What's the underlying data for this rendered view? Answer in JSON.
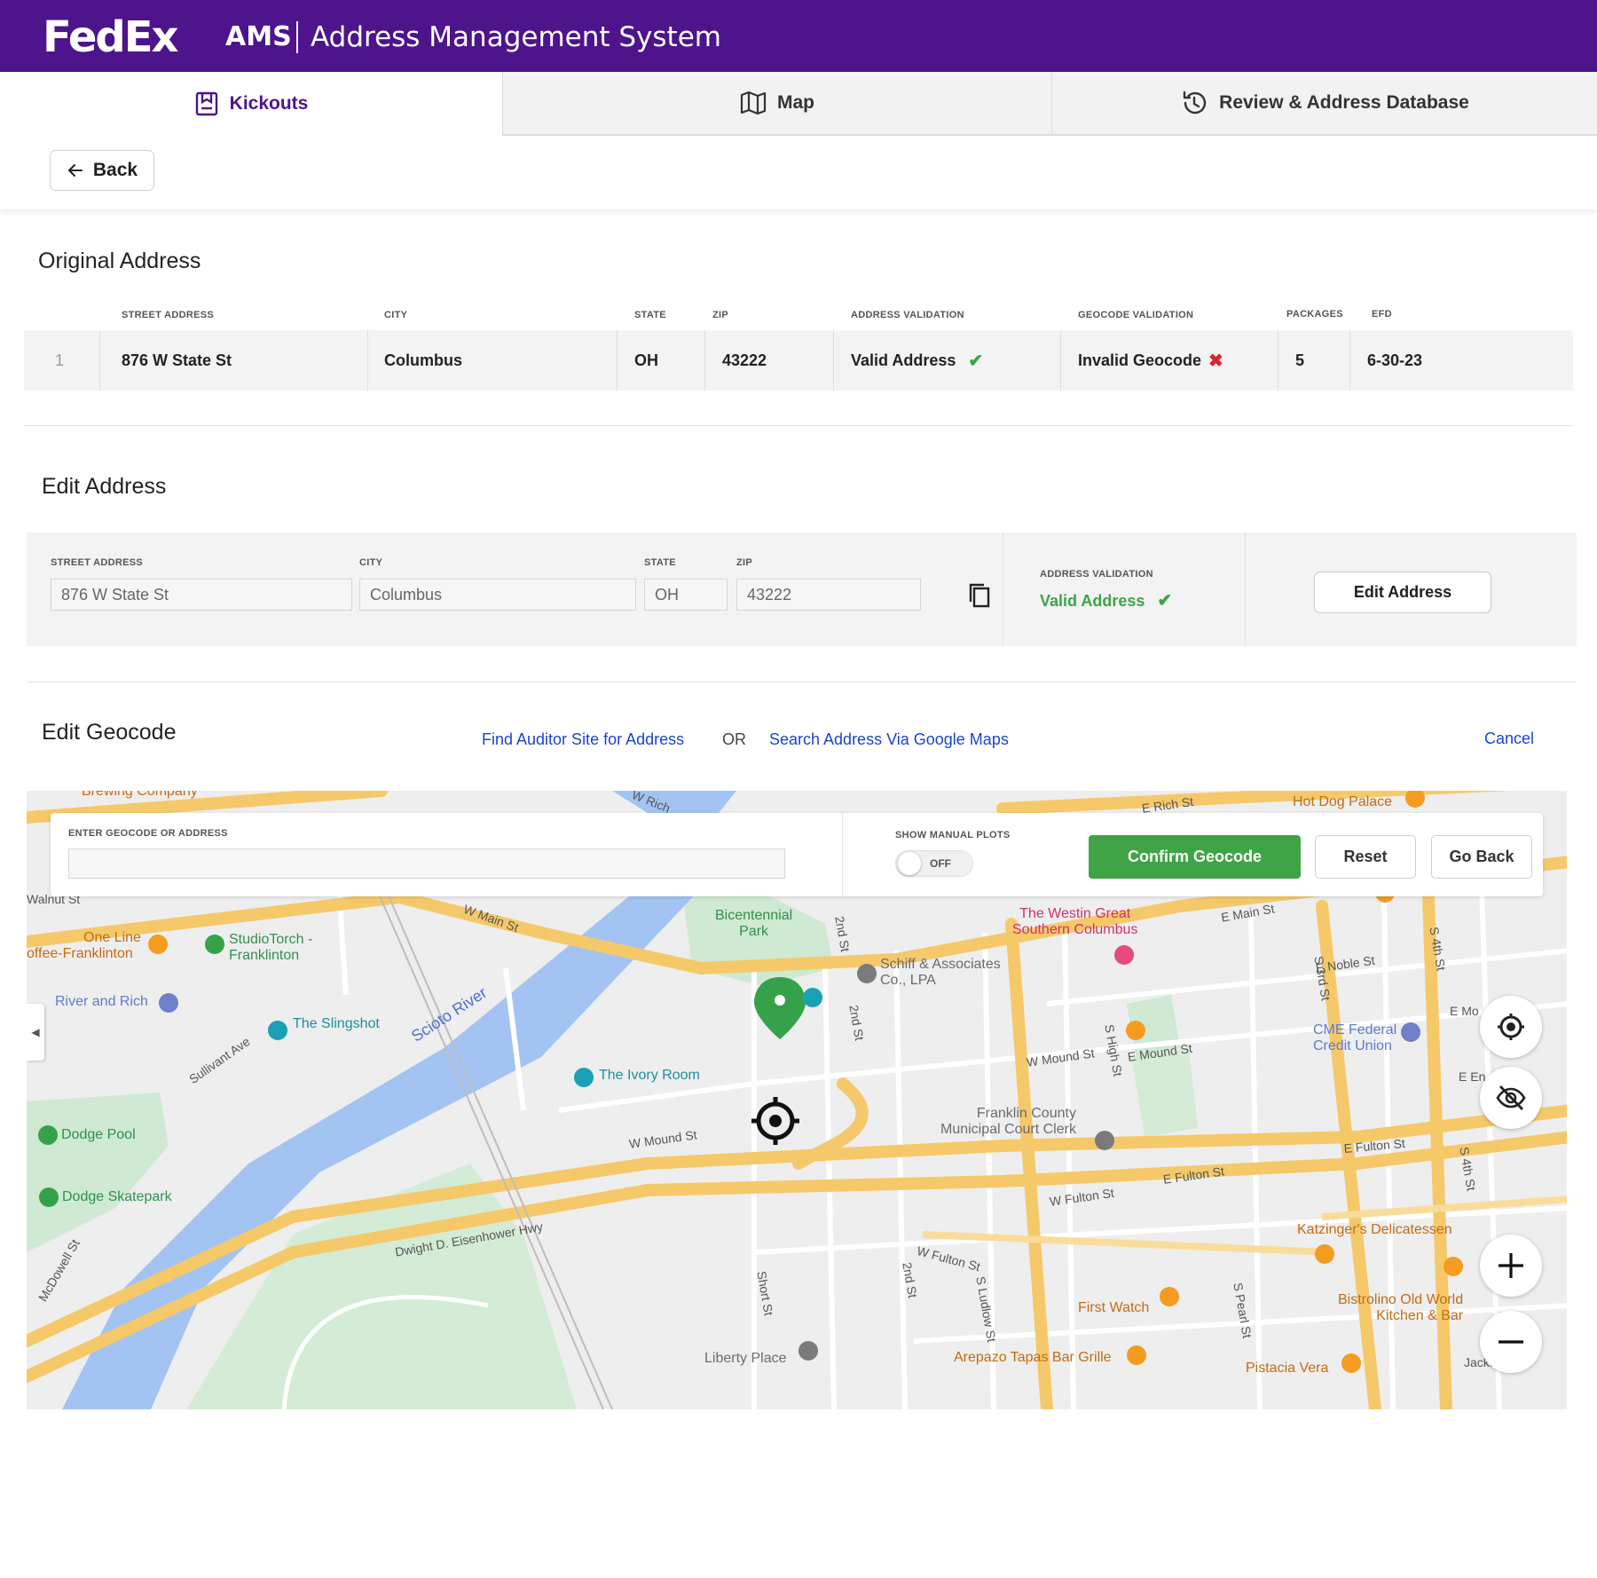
{
  "header": {
    "logo": "FedEx",
    "app_abbr": "AMS",
    "app_name": "Address Management System"
  },
  "tabs": [
    {
      "label": "Kickouts",
      "icon": "clipboard-icon",
      "active": true
    },
    {
      "label": "Map",
      "icon": "map-icon",
      "active": false
    },
    {
      "label": "Review & Address Database",
      "icon": "history-icon",
      "active": false
    }
  ],
  "back_label": "Back",
  "original": {
    "title": "Original Address",
    "headers": {
      "street": "STREET ADDRESS",
      "city": "CITY",
      "state": "STATE",
      "zip": "ZIP",
      "address_validation": "ADDRESS VALIDATION",
      "geocode_validation": "GEOCODE VALIDATION",
      "packages": "PACKAGES",
      "efd": "EFD"
    },
    "row": {
      "num": "1",
      "street": "876 W State St",
      "city": "Columbus",
      "state": "OH",
      "zip": "43222",
      "address_validation": "Valid Address",
      "geocode_validation": "Invalid Geocode",
      "packages": "5",
      "efd": "6-30-23"
    }
  },
  "edit_address": {
    "title": "Edit Address",
    "labels": {
      "street": "STREET ADDRESS",
      "city": "CITY",
      "state": "STATE",
      "zip": "ZIP",
      "validation": "ADDRESS VALIDATION"
    },
    "values": {
      "street": "876 W State St",
      "city": "Columbus",
      "state": "OH",
      "zip": "43222"
    },
    "validation": "Valid Address",
    "button": "Edit Address"
  },
  "edit_geocode": {
    "title": "Edit Geocode",
    "link_auditor": "Find Auditor Site for Address",
    "or": "OR",
    "link_google": "Search Address Via Google Maps",
    "cancel": "Cancel",
    "input_label": "ENTER GEOCODE OR ADDRESS",
    "input_value": "",
    "manual_plots_label": "SHOW MANUAL PLOTS",
    "toggle_state": "OFF",
    "confirm": "Confirm Geocode",
    "reset": "Reset",
    "go_back": "Go Back"
  },
  "map": {
    "places": {
      "bicentennial": "Bicentennial\nPark",
      "westin": "The Westin Great\nSouthern Columbus",
      "schiff": "Schiff & Associates\nCo., LPA",
      "one_line": "One Line",
      "offee_franklinton": "offee-Franklinton",
      "studiotorch": "StudioTorch -\nFranklinton",
      "river_rich": "River and Rich",
      "slingshot": "The Slingshot",
      "ivory_room": "The Ivory Room",
      "dodge_pool": "Dodge Pool",
      "dodge_skatepark": "Dodge Skatepark",
      "franklin_county": "Franklin County\nMunicipal Court Clerk",
      "cme": "CME Federal\nCredit Union",
      "katzinger": "Katzinger's Delicatessen",
      "bistrolino": "Bistrolino Old World\nKitchen & Bar",
      "first_watch": "First Watch",
      "arepazo": "Arepazo Tapas Bar Grille",
      "liberty": "Liberty Place",
      "pistacia": "Pistacia Vera",
      "hot_dog": "Hot Dog Palace",
      "brewing": "Brewing Company",
      "scioto": "Scioto River"
    },
    "streets": {
      "w_main": "W Main St",
      "e_main": "E Main St",
      "e_rich": "E Rich St",
      "w_rich": "W Rich",
      "w_mound": "W Mound St",
      "w_mound2": "W Mound St",
      "e_mound": "E Mound St",
      "e_fulton": "E Fulton St",
      "e_fulton2": "E Fulton St",
      "w_fulton": "W Fulton St",
      "w_fulton2": "W Fulton St",
      "eisenhower": "Dwight D. Eisenhower Hwy",
      "sullivant": "Sullivant Ave",
      "mcdowell": "McDowell St",
      "s_high": "S High St",
      "s_3rd": "S 3rd St",
      "s_4th": "S 4th St",
      "s_4th2": "S 4th St",
      "second": "2nd St",
      "second2": "2nd St",
      "second3": "2nd St",
      "short": "Short St",
      "s_ludlow": "S Ludlow St",
      "s_pearl": "S Pearl St",
      "e_noble": "E Noble St",
      "walnut": "Walnut St",
      "jackson": "Jackson",
      "e_mo": "E Mo",
      "e_en": "E En"
    }
  }
}
